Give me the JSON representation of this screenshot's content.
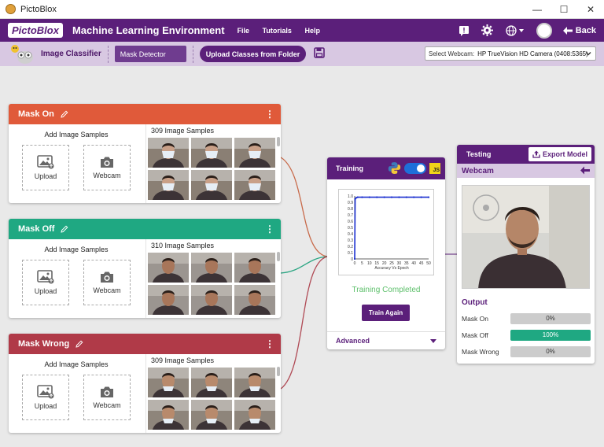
{
  "window": {
    "title": "PictoBlox",
    "minimize": "—",
    "maximize": "☐",
    "close": "✕"
  },
  "header": {
    "logo": "PictoBlox",
    "title": "Machine Learning Environment",
    "menu": [
      "File",
      "Tutorials",
      "Help"
    ],
    "back_label": "Back"
  },
  "toolbar": {
    "project_type": "Image Classifier",
    "project_name": "Mask Detector",
    "upload_label": "Upload Classes from Folder",
    "webcam_select_label": "Select Webcam:",
    "webcam_select_value": "HP TrueVision HD Camera (0408:5365)"
  },
  "classes": [
    {
      "name": "Mask On",
      "color": "#e05a3a",
      "add_title": "Add Image Samples",
      "upload": "Upload",
      "webcam": "Webcam",
      "samples": "309 Image Samples"
    },
    {
      "name": "Mask Off",
      "color": "#1fa882",
      "add_title": "Add Image Samples",
      "upload": "Upload",
      "webcam": "Webcam",
      "samples": "310 Image Samples"
    },
    {
      "name": "Mask Wrong",
      "color": "#b03a48",
      "add_title": "Add Image Samples",
      "upload": "Upload",
      "webcam": "Webcam",
      "samples": "309 Image Samples"
    }
  ],
  "training": {
    "title": "Training",
    "js_label": "JS",
    "status": "Training Completed",
    "train_again": "Train Again",
    "advanced": "Advanced"
  },
  "chart_data": {
    "type": "line",
    "xlabel": "Accuracy Vs Epoch",
    "ylabel": "",
    "xlim": [
      0,
      50
    ],
    "ylim": [
      0,
      1
    ],
    "x_ticks": [
      "0",
      "5",
      "10",
      "15",
      "20",
      "25",
      "30",
      "35",
      "40",
      "45",
      "50"
    ],
    "y_ticks": [
      "0",
      "0.1",
      "0.2",
      "0.3",
      "0.4",
      "0.5",
      "0.6",
      "0.7",
      "0.8",
      "0.9",
      "1.0"
    ],
    "series": [
      {
        "color": "#1a2fd0",
        "x": [
          0,
          0.3,
          1,
          2,
          5,
          10,
          15,
          20,
          25,
          30,
          35,
          40,
          45,
          50
        ],
        "y": [
          0,
          0.95,
          0.97,
          0.98,
          0.98,
          0.98,
          0.98,
          0.98,
          0.98,
          0.98,
          0.98,
          0.98,
          0.98,
          0.98
        ]
      }
    ]
  },
  "testing": {
    "title": "Testing",
    "export_label": "Export Model",
    "source": "Webcam",
    "output_title": "Output",
    "outputs": [
      {
        "name": "Mask On",
        "value": 0,
        "label": "0%",
        "color": "#1fa882"
      },
      {
        "name": "Mask Off",
        "value": 100,
        "label": "100%",
        "color": "#1fa882"
      },
      {
        "name": "Mask Wrong",
        "value": 0,
        "label": "0%",
        "color": "#1fa882"
      }
    ]
  }
}
